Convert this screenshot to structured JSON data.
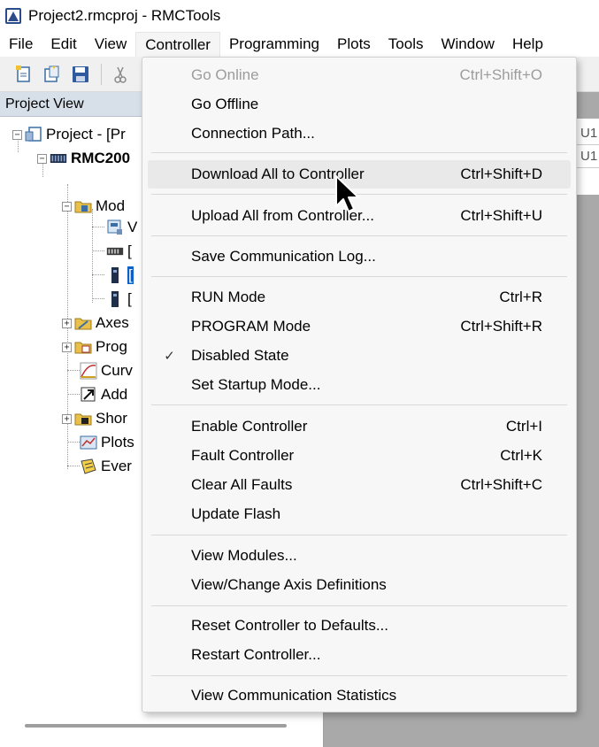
{
  "window": {
    "title": "Project2.rmcproj - RMCTools"
  },
  "menubar": {
    "items": [
      "File",
      "Edit",
      "View",
      "Controller",
      "Programming",
      "Plots",
      "Tools",
      "Window",
      "Help"
    ],
    "active": "Controller"
  },
  "project_view": {
    "header": "Project View",
    "tree": [
      {
        "label": "Project - [Pr",
        "icon": "project-icon"
      },
      {
        "label": "RMC200",
        "icon": "controller-icon"
      },
      {
        "label": "Mod",
        "icon": "modules-folder-icon"
      },
      {
        "label": "V",
        "icon": "module-icon"
      },
      {
        "label": "[",
        "icon": "rack-icon"
      },
      {
        "label": "[",
        "icon": "card-icon"
      },
      {
        "label": "[",
        "icon": "card-icon"
      },
      {
        "label": "Axes",
        "icon": "axes-icon"
      },
      {
        "label": "Prog",
        "icon": "programs-icon"
      },
      {
        "label": "Curv",
        "icon": "curves-icon"
      },
      {
        "label": "Add",
        "icon": "add-icon"
      },
      {
        "label": "Shor",
        "icon": "shortcuts-icon"
      },
      {
        "label": "Plots",
        "icon": "plots-icon"
      },
      {
        "label": "Ever",
        "icon": "events-icon"
      }
    ]
  },
  "right_area": {
    "cells": [
      "U1",
      "U1"
    ]
  },
  "controller_menu": {
    "items": [
      {
        "label": "Go Online",
        "shortcut": "Ctrl+Shift+O"
      },
      {
        "label": "Go Offline",
        "shortcut": ""
      },
      {
        "label": "Connection Path...",
        "shortcut": ""
      },
      {
        "label": "Download All to Controller",
        "shortcut": "Ctrl+Shift+D"
      },
      {
        "label": "Upload All from Controller...",
        "shortcut": "Ctrl+Shift+U"
      },
      {
        "label": "Save Communication Log...",
        "shortcut": ""
      },
      {
        "label": "RUN Mode",
        "shortcut": "Ctrl+R"
      },
      {
        "label": "PROGRAM Mode",
        "shortcut": "Ctrl+Shift+R"
      },
      {
        "label": "Disabled State",
        "shortcut": "",
        "check": "✓"
      },
      {
        "label": "Set Startup Mode...",
        "shortcut": ""
      },
      {
        "label": "Enable Controller",
        "shortcut": "Ctrl+I"
      },
      {
        "label": "Fault Controller",
        "shortcut": "Ctrl+K"
      },
      {
        "label": "Clear All Faults",
        "shortcut": "Ctrl+Shift+C"
      },
      {
        "label": "Update Flash",
        "shortcut": ""
      },
      {
        "label": "View Modules...",
        "shortcut": ""
      },
      {
        "label": "View/Change Axis Definitions",
        "shortcut": ""
      },
      {
        "label": "Reset Controller to Defaults...",
        "shortcut": ""
      },
      {
        "label": "Restart Controller...",
        "shortcut": ""
      },
      {
        "label": "View Communication Statistics",
        "shortcut": ""
      }
    ]
  },
  "colors": {
    "menu_bg": "#f7f7f7",
    "hover": "#e9e9e9",
    "disabled_text": "#9c9c9c",
    "pane_header": "#d7dfe8",
    "workspace": "#a9a9a9"
  }
}
